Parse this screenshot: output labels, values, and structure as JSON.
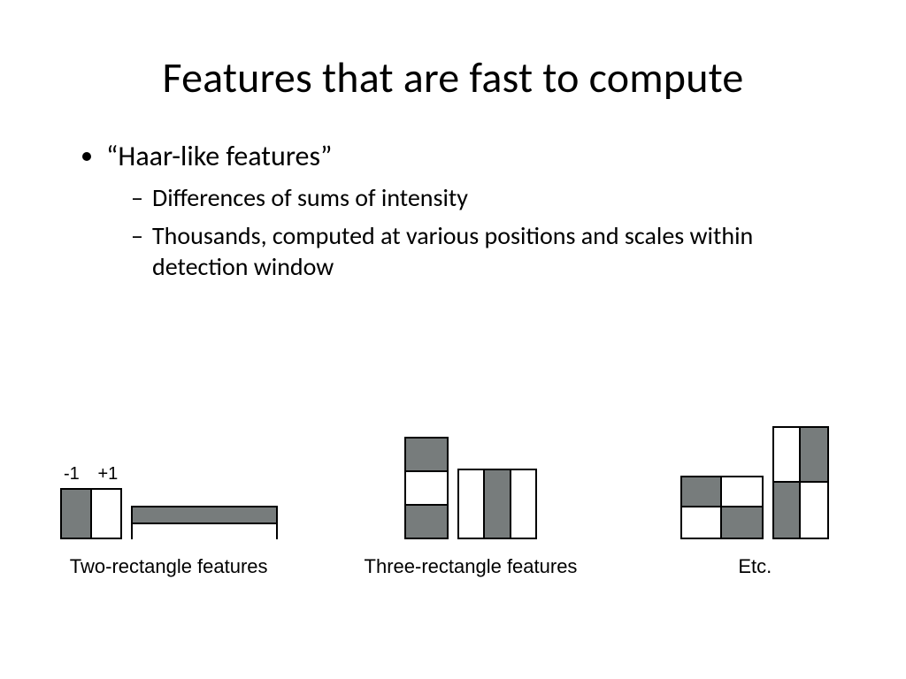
{
  "title": "Features that are fast to compute",
  "bullets": {
    "main": "“Haar-like features”",
    "sub1": "Differences of sums of intensity",
    "sub2": "Thousands, computed at various positions and scales within detection window"
  },
  "annotations": {
    "minus1": "-1",
    "plus1": "+1"
  },
  "captions": {
    "two": "Two-rectangle features",
    "three": "Three-rectangle features",
    "etc": "Etc."
  }
}
